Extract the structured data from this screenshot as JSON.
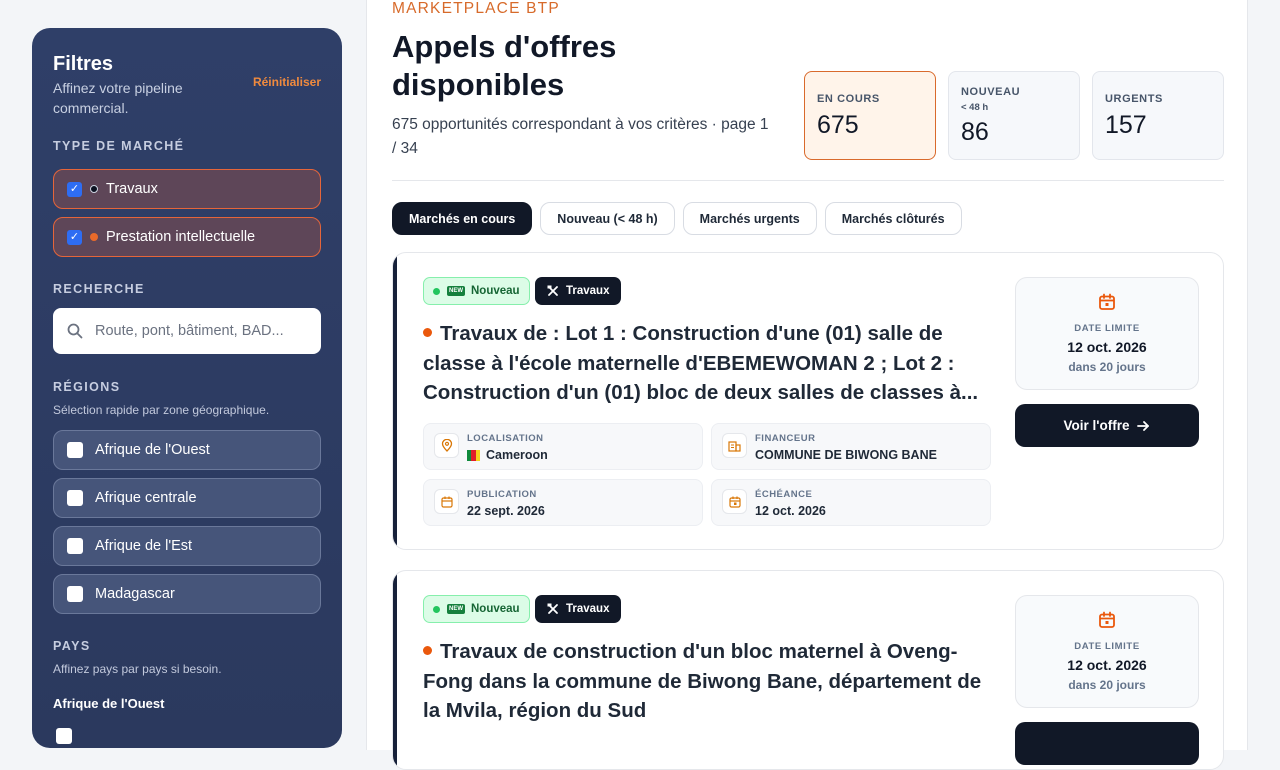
{
  "sidebar": {
    "title": "Filtres",
    "subtitle": "Affinez votre pipeline commercial.",
    "reset": "Réinitialiser",
    "market_type": {
      "heading": "TYPE DE MARCHÉ",
      "options": [
        {
          "label": "Travaux",
          "checked": true,
          "dot_color": "#0b1120"
        },
        {
          "label": "Prestation intellectuelle",
          "checked": true,
          "dot_color": "#ea6a2a"
        }
      ]
    },
    "search": {
      "heading": "RECHERCHE",
      "placeholder": "Route, pont, bâtiment, BAD..."
    },
    "regions": {
      "heading": "RÉGIONS",
      "hint": "Sélection rapide par zone géographique.",
      "options": [
        {
          "label": "Afrique de l'Ouest",
          "checked": false
        },
        {
          "label": "Afrique centrale",
          "checked": false
        },
        {
          "label": "Afrique de l'Est",
          "checked": false
        },
        {
          "label": "Madagascar",
          "checked": false
        }
      ]
    },
    "countries": {
      "heading": "PAYS",
      "hint": "Affinez pays par pays si besoin.",
      "group": "Afrique de l'Ouest"
    }
  },
  "header": {
    "eyebrow": "MARKETPLACE BTP",
    "title": "Appels d'offres disponibles",
    "subtitle": "675 opportunités correspondant à vos critères · page 1 / 34"
  },
  "stats": [
    {
      "label": "EN COURS",
      "sub": "",
      "value": "675",
      "active": true
    },
    {
      "label": "NOUVEAU",
      "sub": "< 48 h",
      "value": "86",
      "active": false
    },
    {
      "label": "URGENTS",
      "sub": "",
      "value": "157",
      "active": false
    }
  ],
  "tabs": [
    "Marchés en cours",
    "Nouveau (< 48 h)",
    "Marchés urgents",
    "Marchés clôturés"
  ],
  "cards": [
    {
      "badge_new": "Nouveau",
      "badge_new_icon": "NEW",
      "badge_type": "Travaux",
      "title": "Travaux de : Lot 1 : Construction d'une (01) salle de classe à l'école maternelle d'EBEMEWOMAN 2 ; Lot 2 : Construction d'un (01) bloc de deux salles de classes à...",
      "location_label": "LOCALISATION",
      "location": "Cameroon",
      "funder_label": "FINANCEUR",
      "funder": "COMMUNE DE BIWONG BANE",
      "publication_label": "PUBLICATION",
      "publication": "22 sept. 2026",
      "due_label": "ÉCHÉANCE",
      "due": "12 oct. 2026",
      "deadline_label": "DATE LIMITE",
      "deadline": "12 oct. 2026",
      "remaining": "dans 20 jours",
      "cta": "Voir l'offre"
    },
    {
      "badge_new": "Nouveau",
      "badge_new_icon": "NEW",
      "badge_type": "Travaux",
      "title": "Travaux de construction d'un bloc maternel à Oveng-Fong dans la commune de Biwong Bane, département de la Mvila, région du Sud",
      "deadline_label": "DATE LIMITE",
      "deadline": "12 oct. 2026",
      "remaining": "dans 20 jours"
    }
  ],
  "colors": {
    "accent": "#ea580c",
    "navy": "#111827",
    "sidebar": "#2f3f68"
  }
}
